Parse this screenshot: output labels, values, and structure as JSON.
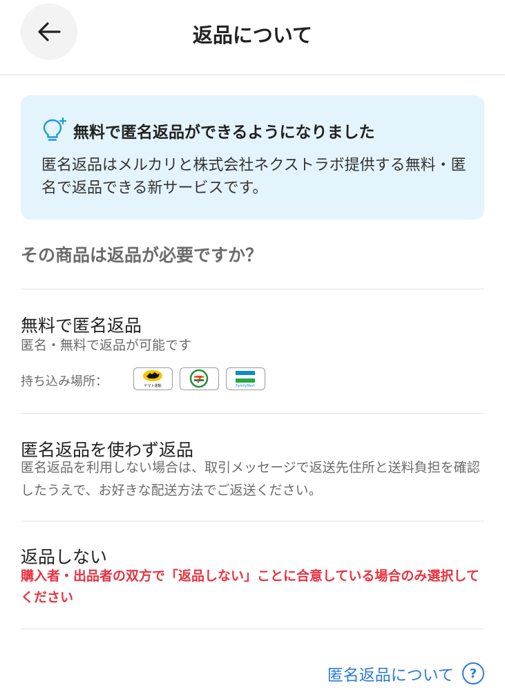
{
  "header": {
    "title": "返品について"
  },
  "info_box": {
    "title": "無料で匿名返品ができるようになりました",
    "description": "匿名返品はメルカリと株式会社ネクストラボ提供する無料・匿名で返品できる新サービスです。"
  },
  "question": "その商品は返品が必要ですか？",
  "options": [
    {
      "title": "無料で匿名返品",
      "description": "匿名・無料で返品が可能です",
      "stores_label": "持ち込み場所：",
      "stores": [
        "yamato-icon",
        "seven-eleven-icon",
        "familymart-icon"
      ],
      "yamato_text": "ヤマト運輸",
      "familymart_text": "FamilyMart",
      "seven_text": "7"
    },
    {
      "title": "匿名返品を使わず返品",
      "description": "匿名返品を利用しない場合は、取引メッセージで返送先住所と送料負担を確認したうえで、お好きな配送方法でご返送ください。"
    },
    {
      "title": "返品しない",
      "description": "購入者・出品者の双方で「返品しない」ことに合意している場合のみ選択してください"
    }
  ],
  "footer": {
    "help_link": "匿名返品について",
    "help_icon": "?"
  },
  "colors": {
    "accent_link": "#2b7bd6",
    "warning": "#e8323f",
    "info_bg": "#e4f4fc"
  }
}
